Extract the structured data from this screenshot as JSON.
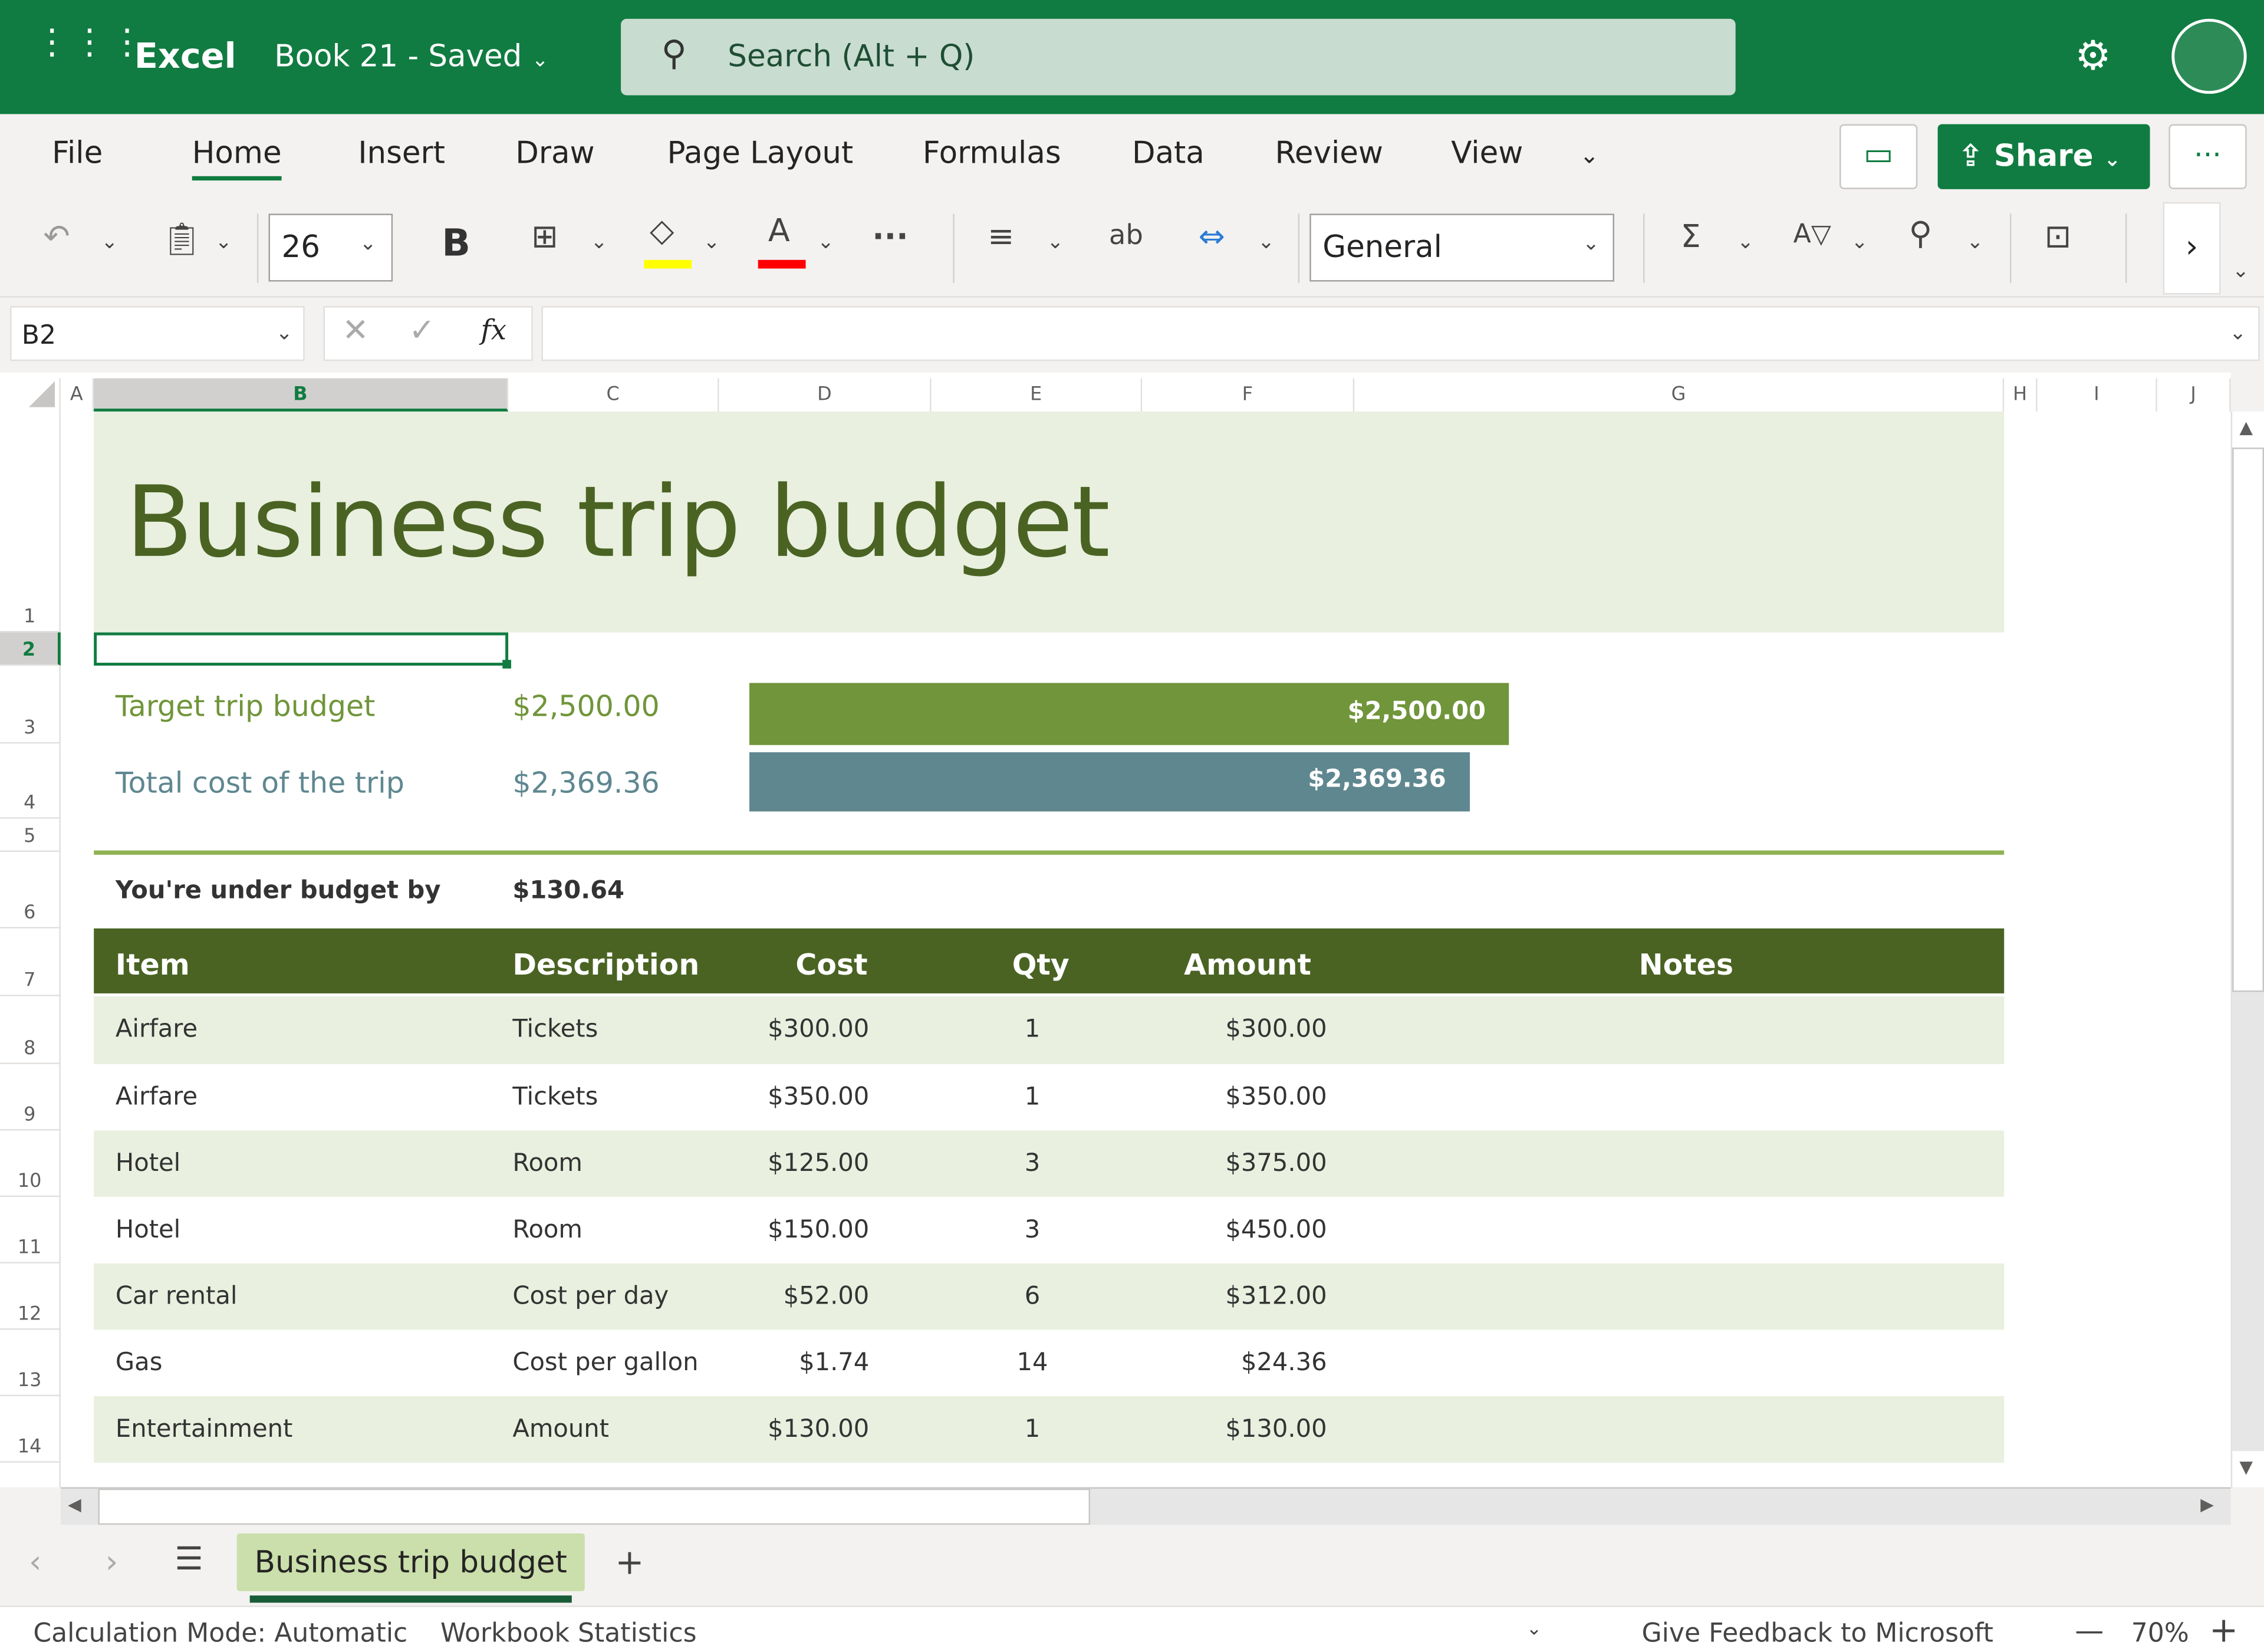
{
  "app": {
    "name": "Excel",
    "doc_title": "Book 21",
    "save_status": "Saved",
    "search_placeholder": "Search (Alt + Q)"
  },
  "ribbon": {
    "tabs": [
      "File",
      "Home",
      "Insert",
      "Draw",
      "Page Layout",
      "Formulas",
      "Data",
      "Review",
      "View"
    ],
    "active_tab": "Home",
    "share_label": "Share",
    "font_size": "26",
    "bold_label": "B",
    "number_format": "General"
  },
  "formula_bar": {
    "name_box": "B2",
    "fx": "fx",
    "value": ""
  },
  "columns": [
    "A",
    "B",
    "C",
    "D",
    "E",
    "F",
    "G",
    "H",
    "I",
    "J"
  ],
  "rows": [
    "1",
    "2",
    "3",
    "4",
    "5",
    "6",
    "7",
    "8",
    "9",
    "10",
    "11",
    "12",
    "13",
    "14"
  ],
  "sheet": {
    "title": "Business trip budget",
    "target_label": "Target trip budget",
    "target_value": "$2,500.00",
    "total_label": "Total cost of the trip",
    "total_value": "$2,369.36",
    "bar_target": 2500,
    "bar_total": 2369.36,
    "under_label": "You're under budget by",
    "under_value": "$130.64",
    "headers": [
      "Item",
      "Description",
      "Cost",
      "Qty",
      "Amount",
      "Notes"
    ],
    "items": [
      [
        "Airfare",
        "Tickets",
        "$300.00",
        "1",
        "$300.00"
      ],
      [
        "Airfare",
        "Tickets",
        "$350.00",
        "1",
        "$350.00"
      ],
      [
        "Hotel",
        "Room",
        "$125.00",
        "3",
        "$375.00"
      ],
      [
        "Hotel",
        "Room",
        "$150.00",
        "3",
        "$450.00"
      ],
      [
        "Car rental",
        "Cost per day",
        "$52.00",
        "6",
        "$312.00"
      ],
      [
        "Gas",
        "Cost per gallon",
        "$1.74",
        "14",
        "$24.36"
      ],
      [
        "Entertainment",
        "Amount",
        "$130.00",
        "1",
        "$130.00"
      ]
    ],
    "colors": {
      "accent": "#107c41",
      "title_bg": "#e9f0df",
      "title_text": "#4a6323",
      "target_bar": "#70953a",
      "total_bar": "#5f8790",
      "header_bg": "#4a6323"
    }
  },
  "sheet_tabs": {
    "active": "Business trip budget"
  },
  "status": {
    "calc": "Calculation Mode: Automatic",
    "stats": "Workbook Statistics",
    "feedback": "Give Feedback to Microsoft",
    "zoom": "70%"
  }
}
